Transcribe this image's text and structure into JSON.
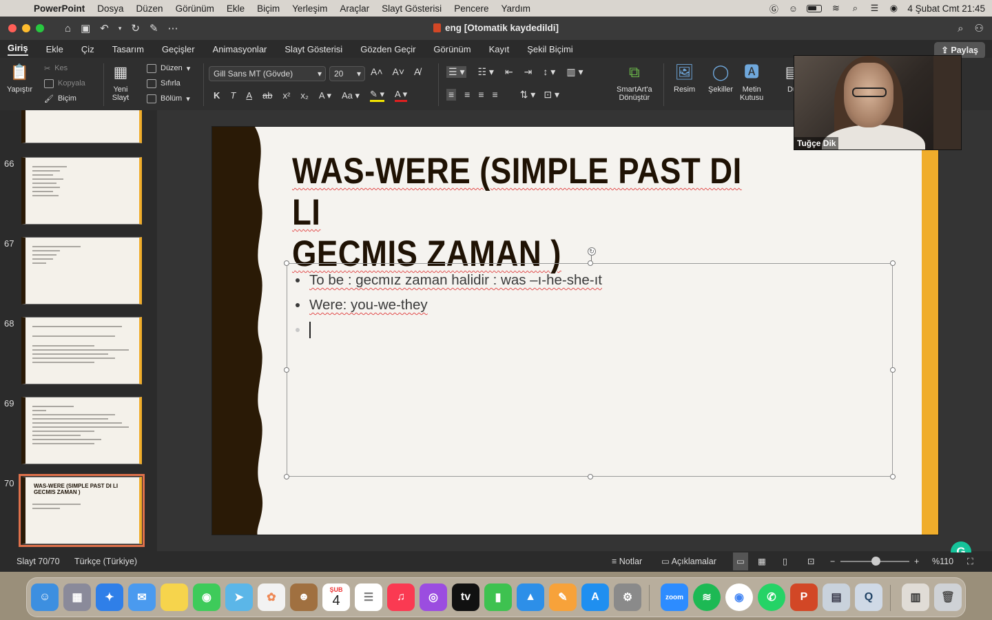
{
  "menubar": {
    "app": "PowerPoint",
    "items": [
      "Dosya",
      "Düzen",
      "Görünüm",
      "Ekle",
      "Biçim",
      "Yerleşim",
      "Araçlar",
      "Slayt Gösterisi",
      "Pencere",
      "Yardım"
    ],
    "datetime": "4 Şubat Cmt  21:45"
  },
  "window": {
    "title": "eng [Otomatik kaydedildi]"
  },
  "tabs": [
    "Giriş",
    "Ekle",
    "Çiz",
    "Tasarım",
    "Geçişler",
    "Animasyonlar",
    "Slayt Gösterisi",
    "Gözden Geçir",
    "Görünüm",
    "Kayıt",
    "Şekil Biçimi"
  ],
  "share_label": "Paylaş",
  "ribbon": {
    "paste": "Yapıştır",
    "cut": "Kes",
    "copy": "Kopyala",
    "format": "Biçim",
    "new_slide": [
      "Yeni",
      "Slayt"
    ],
    "layout": "Düzen",
    "reset": "Sıfırla",
    "section": "Bölüm",
    "font_name": "Gill Sans MT (Gövde)",
    "font_size": "20",
    "smartart": [
      "SmartArt'a",
      "Dönüştür"
    ],
    "picture": "Resim",
    "shapes": "Şekiller",
    "textbox": [
      "Metin",
      "Kutusu"
    ],
    "cutoff": "Dü"
  },
  "thumbnails": [
    {
      "num": "66"
    },
    {
      "num": "67"
    },
    {
      "num": "68"
    },
    {
      "num": "69"
    },
    {
      "num": "70",
      "title": "WAS-WERE (SIMPLE PAST DI LI GECMIS ZAMAN )"
    }
  ],
  "slide": {
    "title_line1": "WAS-WERE (SIMPLE PAST DI LI",
    "title_line2": "GECMIS ZAMAN )",
    "bullet1": "To be : gecmız zaman halidir : was –ı-he-she-ıt",
    "bullet2": "Were: you-we-they"
  },
  "webcam": {
    "name": "Tuğçe Dik"
  },
  "status": {
    "slide": "Slayt 70/70",
    "language": "Türkçe (Türkiye)",
    "notes": "Notlar",
    "comments": "Açıklamalar",
    "zoom": "%110"
  },
  "dock": {
    "calendar_month": "ŞUB",
    "calendar_day": "4",
    "zoom_label": "zoom"
  }
}
